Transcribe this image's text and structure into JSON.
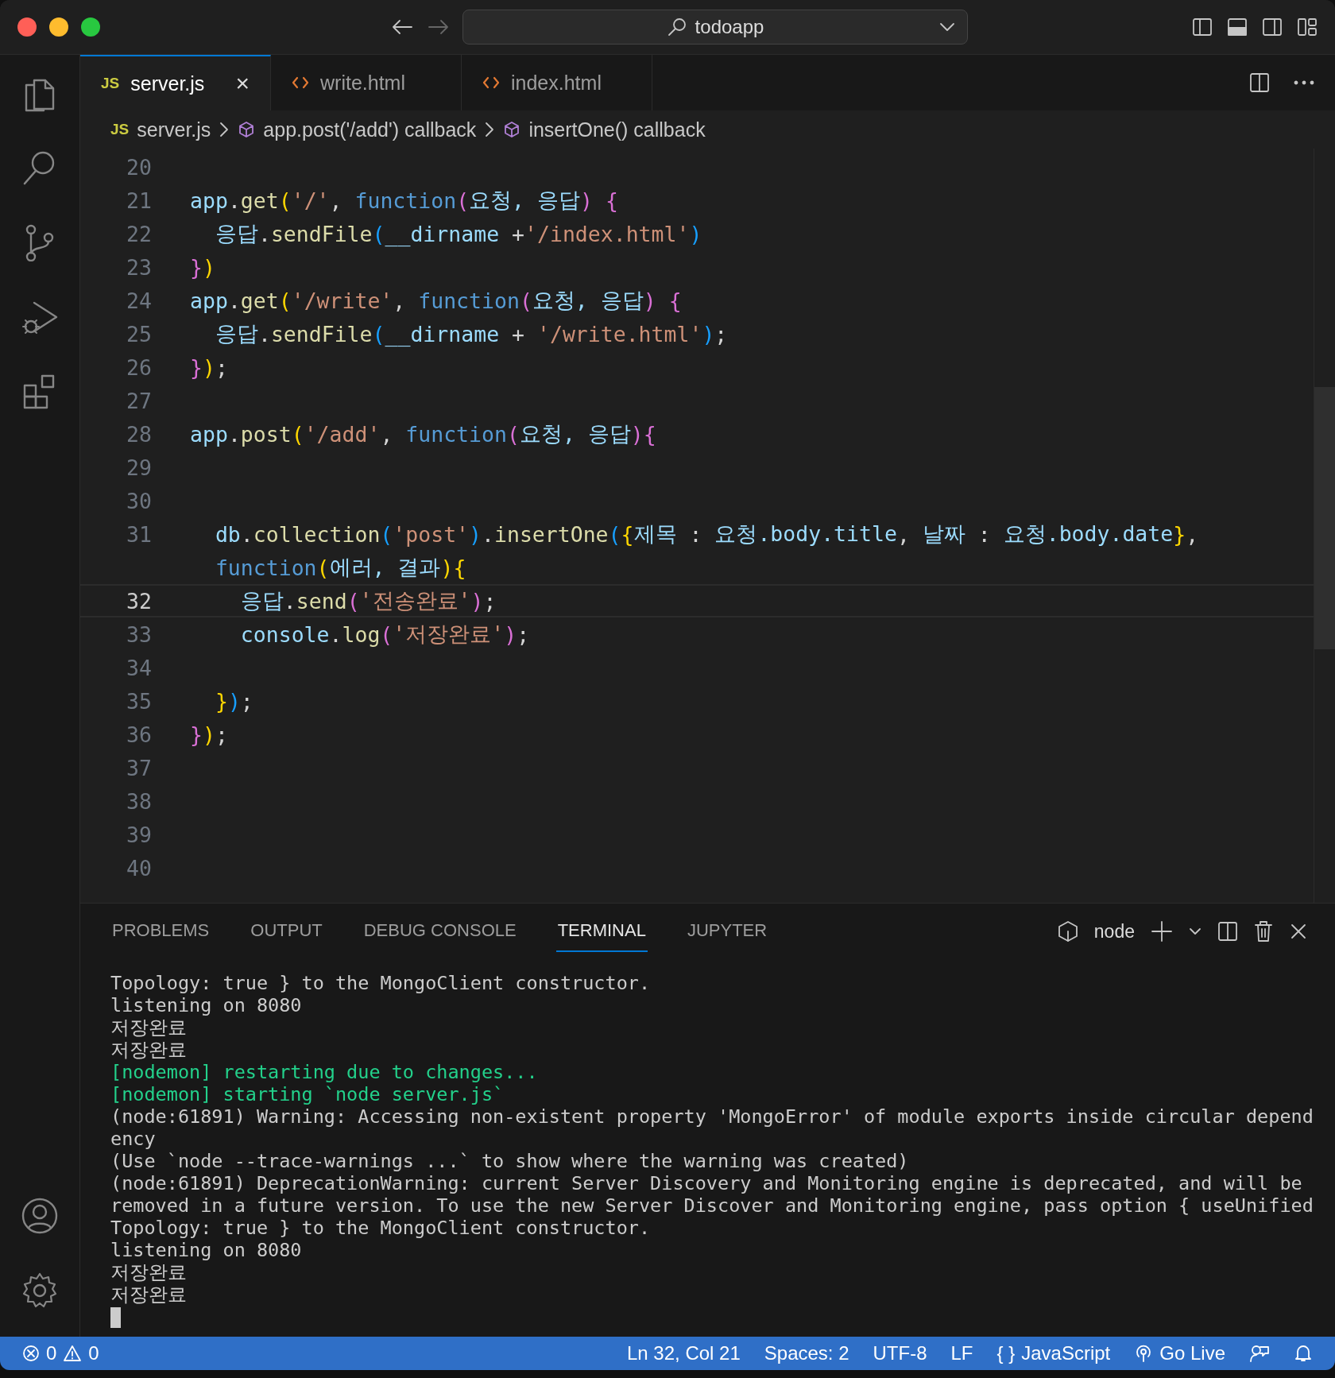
{
  "window": {
    "title": "todoapp"
  },
  "tabs": [
    {
      "kind": "js",
      "icon_text": "JS",
      "label": "server.js",
      "close_icon": "×",
      "selected": true
    },
    {
      "kind": "html",
      "label": "write.html",
      "selected": false
    },
    {
      "kind": "html",
      "label": "index.html",
      "selected": false
    }
  ],
  "breadcrumb": [
    {
      "kind": "file",
      "icon_text": "JS",
      "label": "server.js"
    },
    {
      "kind": "symbol",
      "label": "app.post('/add') callback"
    },
    {
      "kind": "symbol",
      "label": "insertOne() callback"
    }
  ],
  "editor": {
    "lines": [
      {
        "number": "20",
        "current": false
      },
      {
        "number": "21",
        "current": false,
        "tokens": [
          {
            "kind": "var",
            "text": "app"
          },
          {
            "kind": "punct",
            "text": "."
          },
          {
            "kind": "fn",
            "text": "get"
          },
          {
            "kind": "b1",
            "text": "("
          },
          {
            "kind": "str",
            "text": "'/'"
          },
          {
            "kind": "punct",
            "text": ", "
          },
          {
            "kind": "kw",
            "text": "function"
          },
          {
            "kind": "b2",
            "text": "("
          },
          {
            "kind": "var",
            "text": "요청, 응답"
          },
          {
            "kind": "b2",
            "text": ") {"
          }
        ]
      },
      {
        "number": "22",
        "current": false,
        "tokens": [
          {
            "kind": "var",
            "text": "  응답"
          },
          {
            "kind": "punct",
            "text": "."
          },
          {
            "kind": "fn",
            "text": "sendFile"
          },
          {
            "kind": "b3",
            "text": "("
          },
          {
            "kind": "var",
            "text": "__dirname"
          },
          {
            "kind": "punct",
            "text": " +"
          },
          {
            "kind": "str",
            "text": "'/index.html'"
          },
          {
            "kind": "b3",
            "text": ")"
          }
        ]
      },
      {
        "number": "23",
        "current": false,
        "tokens": [
          {
            "kind": "b2",
            "text": "}"
          },
          {
            "kind": "b1",
            "text": ")"
          }
        ]
      },
      {
        "number": "24",
        "current": false,
        "tokens": [
          {
            "kind": "var",
            "text": "app"
          },
          {
            "kind": "punct",
            "text": "."
          },
          {
            "kind": "fn",
            "text": "get"
          },
          {
            "kind": "b1",
            "text": "("
          },
          {
            "kind": "str",
            "text": "'/write'"
          },
          {
            "kind": "punct",
            "text": ", "
          },
          {
            "kind": "kw",
            "text": "function"
          },
          {
            "kind": "b2",
            "text": "("
          },
          {
            "kind": "var",
            "text": "요청, 응답"
          },
          {
            "kind": "b2",
            "text": ") {"
          }
        ]
      },
      {
        "number": "25",
        "current": false,
        "tokens": [
          {
            "kind": "var",
            "text": "  응답"
          },
          {
            "kind": "punct",
            "text": "."
          },
          {
            "kind": "fn",
            "text": "sendFile"
          },
          {
            "kind": "b3",
            "text": "("
          },
          {
            "kind": "var",
            "text": "__dirname"
          },
          {
            "kind": "punct",
            "text": " + "
          },
          {
            "kind": "str",
            "text": "'/write.html'"
          },
          {
            "kind": "b3",
            "text": ")"
          },
          {
            "kind": "punct",
            "text": ";"
          }
        ]
      },
      {
        "number": "26",
        "current": false,
        "tokens": [
          {
            "kind": "b2",
            "text": "}"
          },
          {
            "kind": "b1",
            "text": ")"
          },
          {
            "kind": "punct",
            "text": ";"
          }
        ]
      },
      {
        "number": "27",
        "current": false
      },
      {
        "number": "28",
        "current": false,
        "tokens": [
          {
            "kind": "var",
            "text": "app"
          },
          {
            "kind": "punct",
            "text": "."
          },
          {
            "kind": "fn",
            "text": "post"
          },
          {
            "kind": "b1",
            "text": "("
          },
          {
            "kind": "str",
            "text": "'/add'"
          },
          {
            "kind": "punct",
            "text": ", "
          },
          {
            "kind": "kw",
            "text": "function"
          },
          {
            "kind": "b2",
            "text": "("
          },
          {
            "kind": "var",
            "text": "요청, 응답"
          },
          {
            "kind": "b2",
            "text": ")"
          },
          {
            "kind": "b2",
            "text": "{"
          }
        ]
      },
      {
        "number": "29",
        "current": false
      },
      {
        "number": "30",
        "current": false
      },
      {
        "number": "31",
        "current": false,
        "tokens": [
          {
            "kind": "var",
            "text": "  db"
          },
          {
            "kind": "punct",
            "text": "."
          },
          {
            "kind": "fn",
            "text": "collection"
          },
          {
            "kind": "b3",
            "text": "("
          },
          {
            "kind": "str",
            "text": "'post'"
          },
          {
            "kind": "b3",
            "text": ")"
          },
          {
            "kind": "punct",
            "text": "."
          },
          {
            "kind": "fn",
            "text": "insertOne"
          },
          {
            "kind": "b3",
            "text": "("
          },
          {
            "kind": "b1",
            "text": "{"
          },
          {
            "kind": "var",
            "text": "제목"
          },
          {
            "kind": "punct",
            "text": " : "
          },
          {
            "kind": "var",
            "text": "요청.body.title"
          },
          {
            "kind": "punct",
            "text": ", "
          },
          {
            "kind": "var",
            "text": "날짜"
          },
          {
            "kind": "punct",
            "text": " : "
          },
          {
            "kind": "var",
            "text": "요청.body.date"
          },
          {
            "kind": "b1",
            "text": "}"
          },
          {
            "kind": "punct",
            "text": ","
          }
        ],
        "continuation": [
          {
            "kind": "kw",
            "text": "  function"
          },
          {
            "kind": "b1",
            "text": "("
          },
          {
            "kind": "var",
            "text": "에러, 결과"
          },
          {
            "kind": "b1",
            "text": ")"
          },
          {
            "kind": "b1",
            "text": "{"
          }
        ]
      },
      {
        "number": "32",
        "current": true,
        "tokens": [
          {
            "kind": "var",
            "text": "    응답"
          },
          {
            "kind": "punct",
            "text": "."
          },
          {
            "kind": "fn",
            "text": "send"
          },
          {
            "kind": "b2",
            "text": "("
          },
          {
            "kind": "str",
            "text": "'전송완료'"
          },
          {
            "kind": "b2",
            "text": ")"
          },
          {
            "kind": "punct",
            "text": ";"
          }
        ]
      },
      {
        "number": "33",
        "current": false,
        "tokens": [
          {
            "kind": "var",
            "text": "    console"
          },
          {
            "kind": "punct",
            "text": "."
          },
          {
            "kind": "fn",
            "text": "log"
          },
          {
            "kind": "b2",
            "text": "("
          },
          {
            "kind": "str",
            "text": "'저장완료'"
          },
          {
            "kind": "b2",
            "text": ")"
          },
          {
            "kind": "punct",
            "text": ";"
          }
        ]
      },
      {
        "number": "34",
        "current": false
      },
      {
        "number": "35",
        "current": false,
        "tokens": [
          {
            "kind": "b1",
            "text": "  }"
          },
          {
            "kind": "b3",
            "text": ")"
          },
          {
            "kind": "punct",
            "text": ";"
          }
        ]
      },
      {
        "number": "36",
        "current": false,
        "tokens": [
          {
            "kind": "b2",
            "text": "}"
          },
          {
            "kind": "b1",
            "text": ")"
          },
          {
            "kind": "punct",
            "text": ";"
          }
        ]
      },
      {
        "number": "37",
        "current": false
      },
      {
        "number": "38",
        "current": false
      },
      {
        "number": "39",
        "current": false
      },
      {
        "number": "40",
        "current": false
      }
    ]
  },
  "panel": {
    "tabs": [
      {
        "label": "PROBLEMS",
        "selected": false
      },
      {
        "label": "OUTPUT",
        "selected": false
      },
      {
        "label": "DEBUG CONSOLE",
        "selected": false
      },
      {
        "label": "TERMINAL",
        "selected": true
      },
      {
        "label": "JUPYTER",
        "selected": false
      }
    ],
    "terminal_name": "node",
    "terminal_lines": [
      {
        "kind": "normal",
        "text": "Topology: true } to the MongoClient constructor."
      },
      {
        "kind": "normal",
        "text": "listening on 8080"
      },
      {
        "kind": "normal",
        "text": "저장완료"
      },
      {
        "kind": "normal",
        "text": "저장완료"
      },
      {
        "kind": "nodemon",
        "text": "[nodemon] restarting due to changes..."
      },
      {
        "kind": "nodemon",
        "text": "[nodemon] starting `node server.js`"
      },
      {
        "kind": "normal",
        "text": "(node:61891) Warning: Accessing non-existent property 'MongoError' of module exports inside circular depend"
      },
      {
        "kind": "normal",
        "text": "ency"
      },
      {
        "kind": "normal",
        "text": "(Use `node --trace-warnings ...` to show where the warning was created)"
      },
      {
        "kind": "normal",
        "text": "(node:61891) DeprecationWarning: current Server Discovery and Monitoring engine is deprecated, and will be"
      },
      {
        "kind": "normal",
        "text": "removed in a future version. To use the new Server Discover and Monitoring engine, pass option { useUnified"
      },
      {
        "kind": "normal",
        "text": "Topology: true } to the MongoClient constructor."
      },
      {
        "kind": "normal",
        "text": "listening on 8080"
      },
      {
        "kind": "normal",
        "text": "저장완료"
      },
      {
        "kind": "normal",
        "text": "저장완료"
      }
    ]
  },
  "status_bar": {
    "errors": "0",
    "warnings": "0",
    "items": [
      {
        "kind": "text",
        "label": "Ln 32, Col 21"
      },
      {
        "kind": "text",
        "label": "Spaces: 2"
      },
      {
        "kind": "text",
        "label": "UTF-8"
      },
      {
        "kind": "text",
        "label": "LF"
      },
      {
        "kind": "language",
        "icon_text": "{ }",
        "label": "JavaScript"
      },
      {
        "kind": "golive",
        "label": "Go Live"
      }
    ]
  }
}
